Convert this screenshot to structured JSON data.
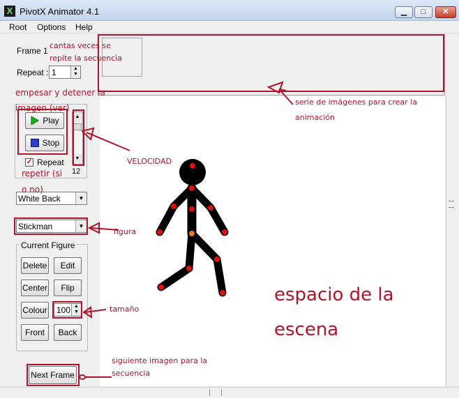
{
  "window": {
    "title": "PivotX Animator 4.1",
    "minimize_glyph": "▁",
    "maximize_glyph": "□",
    "close_glyph": "✕"
  },
  "menu": {
    "items": [
      "Root",
      "Options",
      "Help"
    ]
  },
  "left_panel": {
    "frame_label": "Frame 1",
    "repeat_label": "Repeat :",
    "repeat_value": "1",
    "play_label": "Play",
    "stop_label": "Stop",
    "repeat_checkbox_label": "Repeat",
    "speed_value": "12",
    "background_select": "White Back",
    "figure_select": "Stickman",
    "current_figure_title": "Current Figure",
    "buttons": {
      "delete": "Delete",
      "edit": "Edit",
      "center": "Center",
      "flip": "Flip",
      "colour": "Colour",
      "front": "Front",
      "back": "Back"
    },
    "size_value": "100",
    "next_frame": "Next Frame"
  },
  "annotations": {
    "repeat_note": "cantas veces se repite la secuencia",
    "play_note": "empesar y detener la imagen (ver)",
    "repeat_note2": "repetir (si o no)",
    "speed_note": "VELOCIDAD",
    "strip_note": "serie de imágenes para crear la animación",
    "figure_note": "figura",
    "size_note": "tamaño",
    "next_note": "siguiente imagen para la secuencia",
    "scene_line1": "espacio de la",
    "scene_line2": "escena"
  },
  "colors": {
    "annotation_red": "#b0142a",
    "stick_black": "#000000",
    "joint_red": "#dd1111",
    "joint_orange": "#e87a1a"
  },
  "icons": {
    "play": "play-triangle-icon",
    "stop": "stop-square-icon",
    "app": "pivot-app-icon"
  }
}
